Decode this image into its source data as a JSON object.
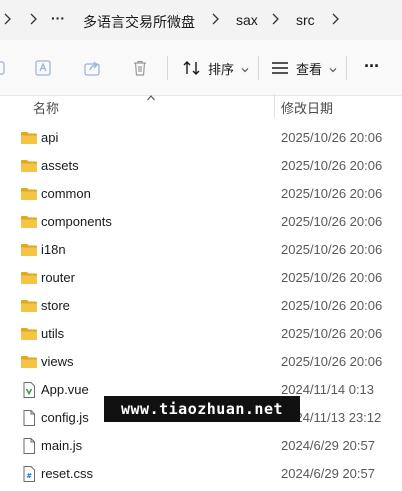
{
  "breadcrumb": {
    "more": "···",
    "items": [
      "多语言交易所微盘",
      "sax",
      "src"
    ]
  },
  "toolbar": {
    "sort_label": "排序",
    "view_label": "查看",
    "more_label": "···"
  },
  "columns": {
    "name": "名称",
    "date_modified": "修改日期"
  },
  "files": [
    {
      "name": "api",
      "date": "2025/10/26 20:06",
      "type": "folder"
    },
    {
      "name": "assets",
      "date": "2025/10/26 20:06",
      "type": "folder"
    },
    {
      "name": "common",
      "date": "2025/10/26 20:06",
      "type": "folder"
    },
    {
      "name": "components",
      "date": "2025/10/26 20:06",
      "type": "folder"
    },
    {
      "name": "i18n",
      "date": "2025/10/26 20:06",
      "type": "folder"
    },
    {
      "name": "router",
      "date": "2025/10/26 20:06",
      "type": "folder"
    },
    {
      "name": "store",
      "date": "2025/10/26 20:06",
      "type": "folder"
    },
    {
      "name": "utils",
      "date": "2025/10/26 20:06",
      "type": "folder"
    },
    {
      "name": "views",
      "date": "2025/10/26 20:06",
      "type": "folder"
    },
    {
      "name": "App.vue",
      "date": "2024/11/14 0:13",
      "type": "vue"
    },
    {
      "name": "config.js",
      "date": "2024/11/13 23:12",
      "type": "file"
    },
    {
      "name": "main.js",
      "date": "2024/6/29 20:57",
      "type": "file"
    },
    {
      "name": "reset.css",
      "date": "2024/6/29 20:57",
      "type": "css"
    }
  ],
  "watermark": "www.tiaozhuan.net",
  "colors": {
    "folder": "#f4c542",
    "folder_dark": "#e0a81e",
    "accent": "#1a73e8"
  }
}
